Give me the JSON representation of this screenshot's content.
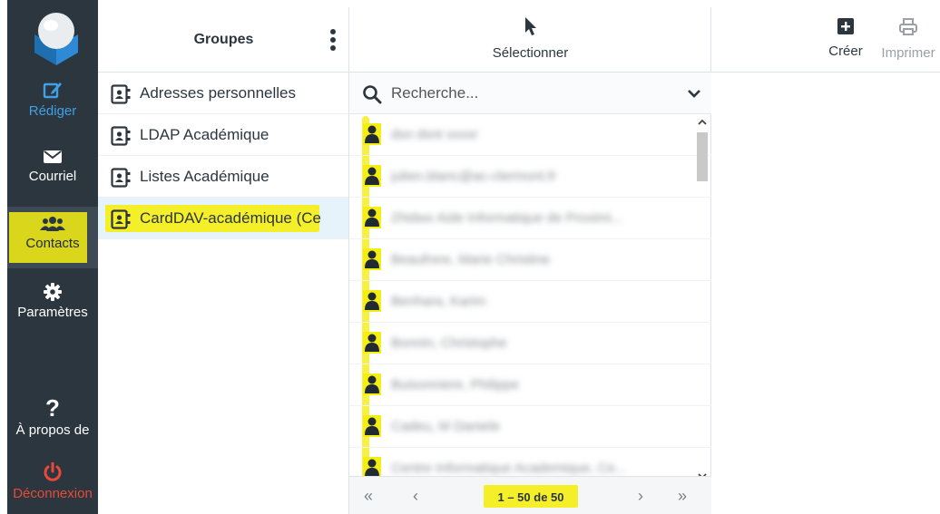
{
  "nav": {
    "compose": "Rédiger",
    "mail": "Courriel",
    "contacts": "Contacts",
    "settings": "Paramètres",
    "about": "À propos de",
    "logout": "Déconnexion"
  },
  "groups": {
    "title": "Groupes",
    "items": [
      {
        "label": "Adresses personnelles"
      },
      {
        "label": "LDAP Académique"
      },
      {
        "label": "Listes Académique"
      },
      {
        "label": "CardDAV-académique (Ce"
      }
    ]
  },
  "list": {
    "select_label": "Sélectionner",
    "search_placeholder": "Recherche...",
    "contacts": [
      {
        "name": "dsn dsnt xxxxr"
      },
      {
        "name": "julien.blanc@ac-clermont.fr"
      },
      {
        "name": "ZNdwx Aide Informatique de Proximi..."
      },
      {
        "name": "Beaufrere, Marie Christine"
      },
      {
        "name": "Benhara, Karim"
      },
      {
        "name": "Bonnin, Christophe"
      },
      {
        "name": "Buisonniere, Philippe"
      },
      {
        "name": "Cadeu, M Daniele"
      },
      {
        "name": "Centre Informatique Academique, Ce..."
      }
    ],
    "pager_count": "1 – 50 de 50"
  },
  "toolbar": {
    "create": "Créer",
    "print": "Imprimer"
  },
  "colors": {
    "nav_bg": "#2c363f",
    "accent_blue": "#3ea0e6",
    "logout_red": "#e84a3a",
    "highlighter": "#f5ee12",
    "selected_row": "#e6f3fb"
  }
}
